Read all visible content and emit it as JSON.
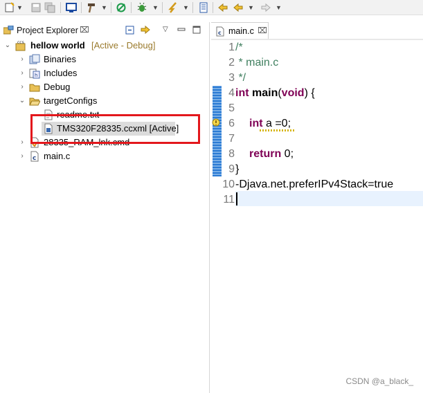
{
  "toolbar": {
    "icons": [
      "new-icon",
      "save-icon",
      "save-all-icon",
      "terminal-icon",
      "build-hammer-icon",
      "debug-link-icon",
      "debug-bug-icon",
      "flash-icon",
      "open-perspective-icon",
      "back-icon",
      "forward-icon"
    ]
  },
  "explorer": {
    "tab_title": "Project Explorer",
    "close_glyph": "⌧",
    "project": {
      "name": "hellow world",
      "status": "[Active - Debug]"
    },
    "items": [
      {
        "label": "Binaries",
        "icon": "binaries-icon"
      },
      {
        "label": "Includes",
        "icon": "includes-icon"
      },
      {
        "label": "Debug",
        "icon": "folder-icon"
      },
      {
        "label": "targetConfigs",
        "icon": "folder-open-icon"
      },
      {
        "label": "readme.txt",
        "icon": "text-file-icon"
      },
      {
        "label": "TMS320F28335.ccxml [Active]",
        "icon": "ccxml-file-icon"
      },
      {
        "label": "28335_RAM_lnk.cmd",
        "icon": "cmd-file-icon"
      },
      {
        "label": "main.c",
        "icon": "c-file-icon"
      }
    ]
  },
  "editor": {
    "tab_title": "main.c",
    "close_glyph": "⌧",
    "line_numbers": [
      "1",
      "2",
      "3",
      "4",
      "5",
      "6",
      "7",
      "8",
      "9",
      "10",
      "11"
    ],
    "code": {
      "l1": "/*",
      "l2": " * main.c",
      "l3": " */",
      "l4_kw1": "int",
      "l4_name": " main",
      "l4_open": "(",
      "l4_kw2": "void",
      "l4_close": ") {",
      "l6_kw": "int",
      "l6_rest": " a =0;",
      "l8_kw": "return",
      "l8_rest": " 0;",
      "l9": "}",
      "l10": "-Djava.net.preferIPv4Stack=true"
    }
  },
  "watermark": "CSDN @a_black_",
  "colors": {
    "highlight_box": "#e3171c",
    "keyword": "#7f0055",
    "comment": "#3f7f5f",
    "active_status": "#9a7a2c"
  }
}
